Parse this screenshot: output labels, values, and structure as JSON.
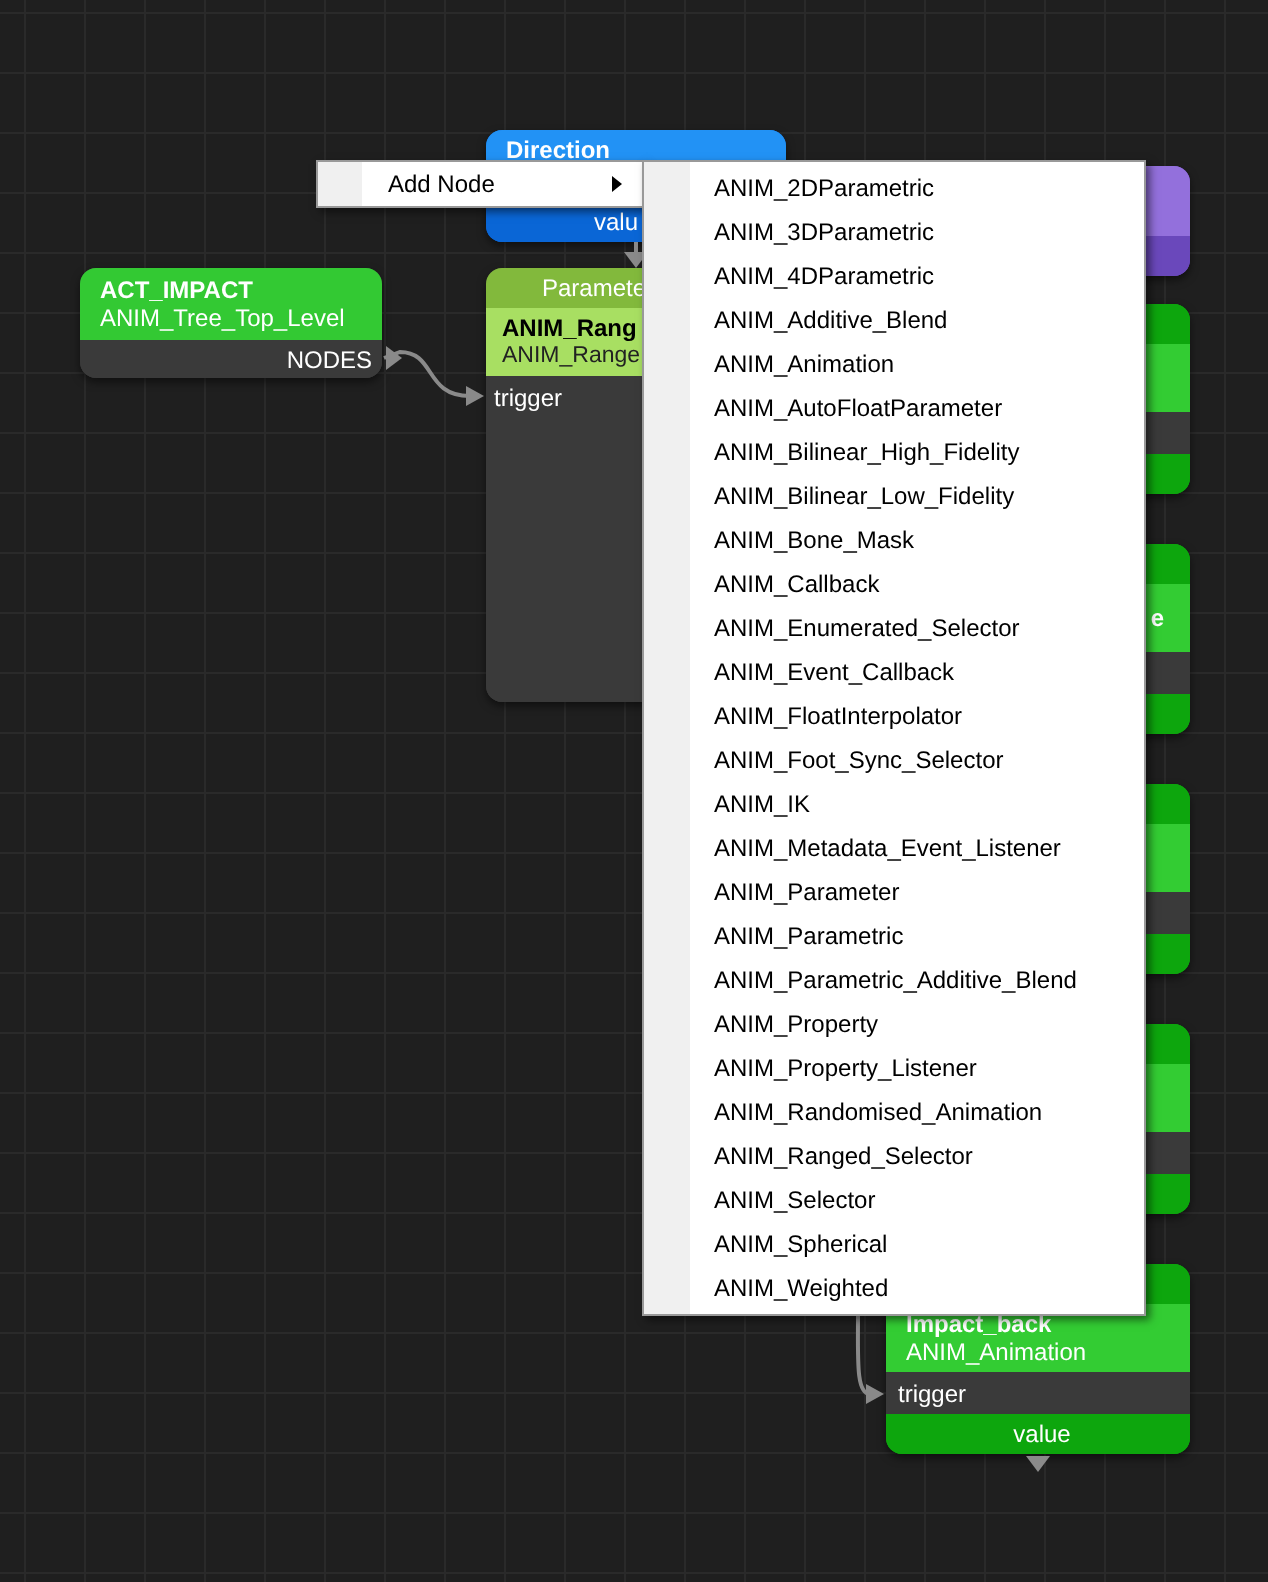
{
  "canvas": {
    "nodes": [
      {
        "kind": "value",
        "header": "Direction",
        "output": "valu"
      },
      {
        "kind": "root",
        "title": "ACT_IMPACT",
        "subtitle": "ANIM_Tree_Top_Level",
        "output": "NODES"
      },
      {
        "kind": "selector",
        "header": "Paramete",
        "title": "ANIM_Rang",
        "subtitle": "ANIM_Range",
        "input": "trigger"
      },
      {
        "kind": "event"
      },
      {
        "kind": "animation"
      },
      {
        "kind": "animation",
        "title_fragment": "e"
      },
      {
        "kind": "animation"
      },
      {
        "kind": "animation"
      },
      {
        "kind": "animation",
        "title": "Impact_back",
        "subtitle": "ANIM_Animation",
        "input": "trigger",
        "output": "value"
      }
    ]
  },
  "context_menu": {
    "items": [
      {
        "label": "Add Node",
        "has_submenu": true
      }
    ]
  },
  "submenu": {
    "items": [
      "ANIM_2DParametric",
      "ANIM_3DParametric",
      "ANIM_4DParametric",
      "ANIM_Additive_Blend",
      "ANIM_Animation",
      "ANIM_AutoFloatParameter",
      "ANIM_Bilinear_High_Fidelity",
      "ANIM_Bilinear_Low_Fidelity",
      "ANIM_Bone_Mask",
      "ANIM_Callback",
      "ANIM_Enumerated_Selector",
      "ANIM_Event_Callback",
      "ANIM_FloatInterpolator",
      "ANIM_Foot_Sync_Selector",
      "ANIM_IK",
      "ANIM_Metadata_Event_Listener",
      "ANIM_Parameter",
      "ANIM_Parametric",
      "ANIM_Parametric_Additive_Blend",
      "ANIM_Property",
      "ANIM_Property_Listener",
      "ANIM_Randomised_Animation",
      "ANIM_Ranged_Selector",
      "ANIM_Selector",
      "ANIM_Spherical",
      "ANIM_Weighted"
    ]
  }
}
